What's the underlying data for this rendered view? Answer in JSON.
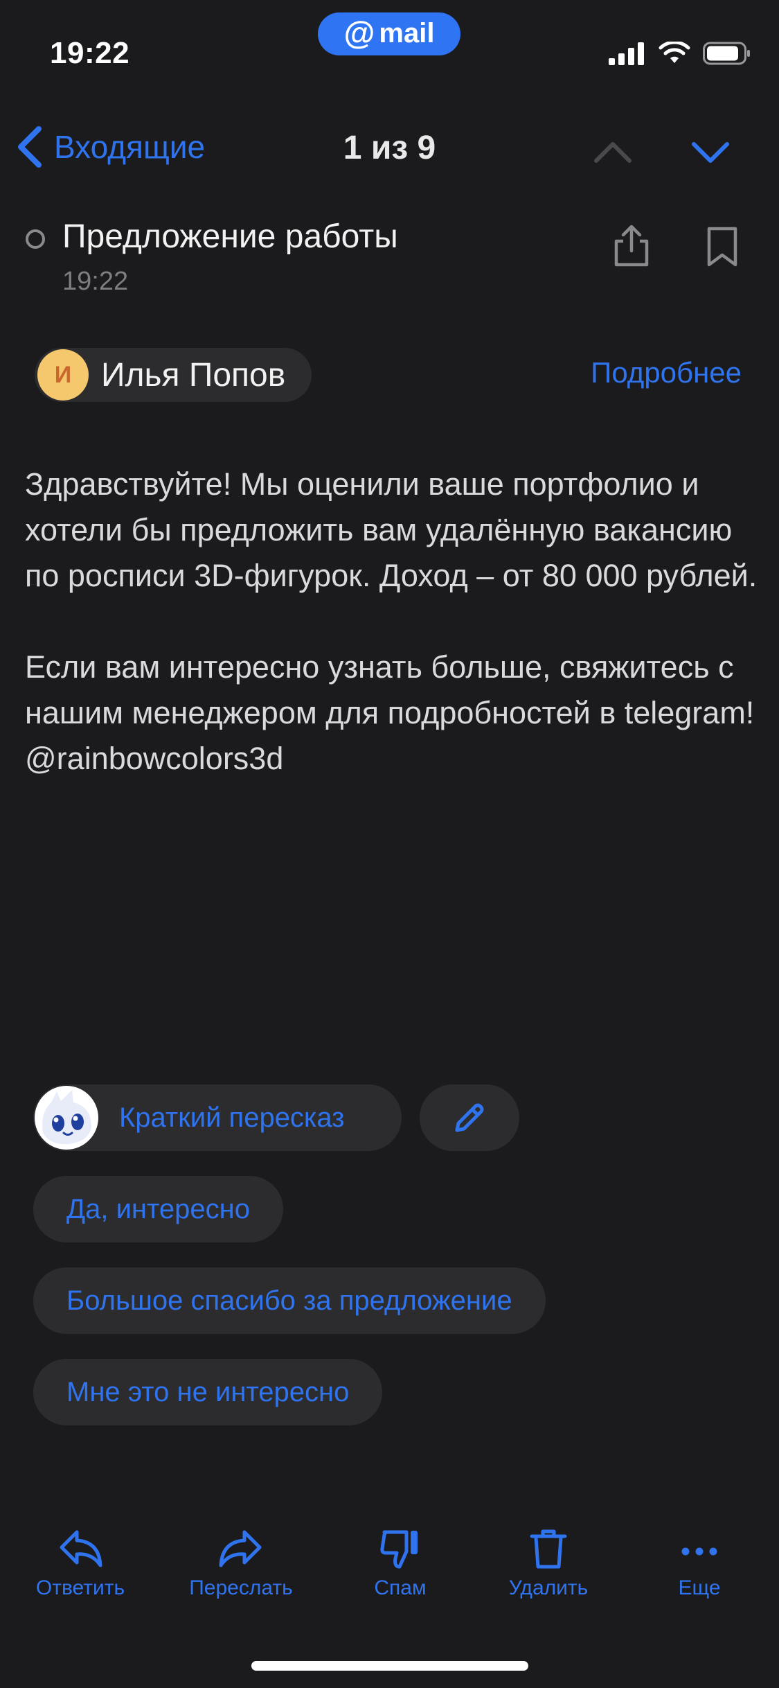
{
  "status_bar": {
    "time": "19:22",
    "app_badge": {
      "at": "@",
      "label": "mail"
    }
  },
  "nav": {
    "back_label": "Входящие",
    "counter": "1 из 9"
  },
  "message": {
    "subject": "Предложение работы",
    "time": "19:22",
    "sender": {
      "initial": "И",
      "name": "Илья Попов"
    },
    "details_label": "Подробнее",
    "body": [
      "Здравствуйте! Мы оценили ваше портфолио и хотели бы предложить вам удалённую вакансию по росписи 3D-фигурок. Доход – от 80 000 рублей.",
      "Если вам интересно узнать больше, свяжитесь с нашим менеджером для подробностей в telegram! @rainbowcolors3d"
    ]
  },
  "ai_actions": {
    "summary_label": "Краткий пересказ",
    "replies": [
      "Да, интересно",
      "Большое спасибо за предложение",
      "Мне это не интересно"
    ]
  },
  "toolbar": {
    "reply": "Ответить",
    "forward": "Переслать",
    "spam": "Спам",
    "delete": "Удалить",
    "more": "Еще"
  },
  "colors": {
    "background": "#1b1b1d",
    "accent": "#2f74ee",
    "chip": "#2c2c2e",
    "avatar": "#f5c86d"
  }
}
